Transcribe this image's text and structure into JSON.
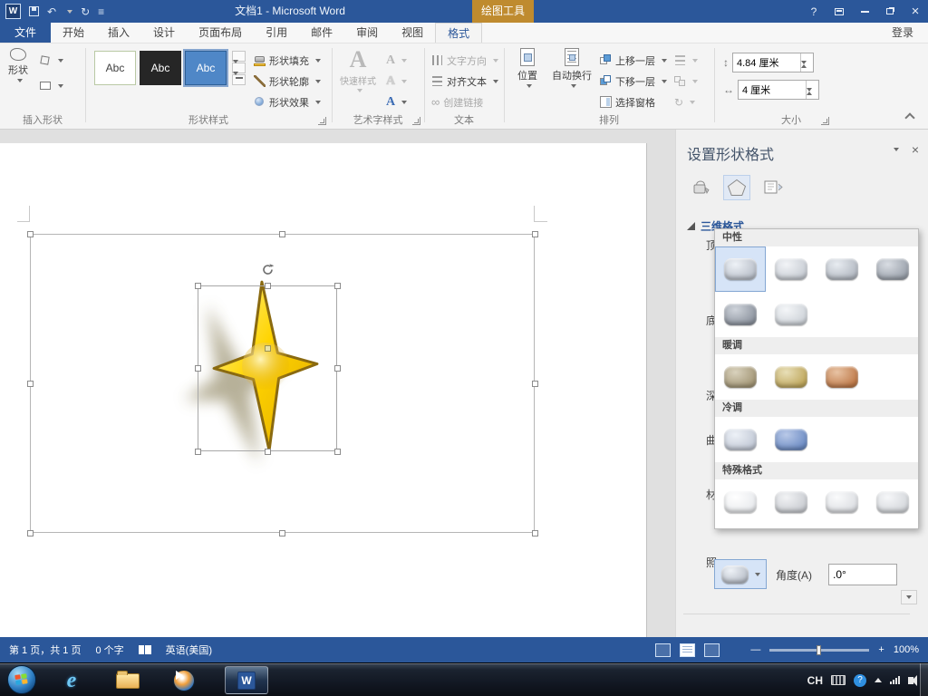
{
  "colors": {
    "titlebar_bg": "#2b579a",
    "contextual_bg": "#bf8b2f",
    "ribbon_bg": "#f4f4f4",
    "tabstrip_bg": "#f7f7f7",
    "accent": "#2b579a",
    "doc_bg": "#e0e0e0",
    "panel_bg": "#f0f0f0",
    "statusbar_bg": "#2b579a",
    "star_fill": "#ffd400",
    "star_stroke": "#8a6a10",
    "star_shadow": "#6e6233",
    "selection_fill": "#d6e4f7",
    "selection_border": "#84a7d3"
  },
  "icons": {
    "undo": "↶",
    "redo": "↻",
    "customize": "≡",
    "help": "?"
  },
  "titlebar": {
    "title": "文档1 - Microsoft Word",
    "contextual_label": "绘图工具"
  },
  "tabs": {
    "file": "文件",
    "items": [
      "开始",
      "插入",
      "设计",
      "页面布局",
      "引用",
      "邮件",
      "审阅",
      "视图"
    ],
    "active": "格式",
    "signin": "登录"
  },
  "ribbon": {
    "insert_shapes": {
      "label": "插入形状",
      "shapes": "形状"
    },
    "shape_styles": {
      "label": "形状样式",
      "tiles": [
        {
          "label": "Abc",
          "bg": "#ffffff",
          "fg": "#404040",
          "border": "#b9c9a4"
        },
        {
          "label": "Abc",
          "bg": "#262626",
          "fg": "#ffffff",
          "border": "#262626"
        },
        {
          "label": "Abc",
          "bg": "#4f87c7",
          "fg": "#ffffff",
          "border": "#2e5f96",
          "selected": true
        }
      ],
      "fill": "形状填充",
      "outline": "形状轮廓",
      "effects": "形状效果"
    },
    "wordart": {
      "label": "艺术字样式",
      "quick_styles": "快速样式",
      "letter": "A"
    },
    "text": {
      "label": "文本",
      "direction": "文字方向",
      "align": "对齐文本",
      "link": "创建链接"
    },
    "arrange": {
      "label": "排列",
      "position": "位置",
      "wrap": "自动换行",
      "forward": "上移一层",
      "backward": "下移一层",
      "pane": "选择窗格"
    },
    "size": {
      "label": "大小",
      "height_value": "4.84 厘米",
      "width_value": "4 厘米"
    }
  },
  "pane": {
    "title": "设置形状格式",
    "section": "三维格式",
    "row_labels": [
      "顶",
      "底",
      "深",
      "曲",
      "材",
      "照"
    ],
    "angle_label": "角度(A)",
    "angle_value": ".0°",
    "gallery": [
      {
        "header": "中性",
        "items": [
          {
            "base": "#b9bfc9",
            "light": "#eef2f7",
            "selected": true
          },
          {
            "base": "#c7ccd3",
            "light": "#f2f4f7"
          },
          {
            "base": "#b3b9c2",
            "light": "#e8ecf1"
          },
          {
            "base": "#9aa1ab",
            "light": "#d9dde3"
          },
          {
            "base": "#8d949f",
            "light": "#cfd4db"
          },
          {
            "base": "#ced3d9",
            "light": "#f4f6f8"
          }
        ]
      },
      {
        "header": "暖调",
        "items": [
          {
            "base": "#a39676",
            "light": "#d9d2bd"
          },
          {
            "base": "#bfa75c",
            "light": "#e8dfb8"
          },
          {
            "base": "#bf7a49",
            "light": "#e8c3a4"
          }
        ]
      },
      {
        "header": "冷调",
        "items": [
          {
            "base": "#c2c9d6",
            "light": "#edf1f7"
          },
          {
            "base": "#6d8cc4",
            "light": "#b9c9e8"
          }
        ]
      },
      {
        "header": "特殊格式",
        "items": [
          {
            "base": "#e8eaed",
            "light": "#ffffff"
          },
          {
            "base": "#c9ccd1",
            "light": "#f2f3f5"
          },
          {
            "base": "#dcdee2",
            "light": "#fafbfc"
          },
          {
            "base": "#d4d7db",
            "light": "#f6f7f9"
          }
        ]
      }
    ]
  },
  "statusbar": {
    "page_info": "第 1 页，共 1 页",
    "word_count": "0 个字",
    "language": "英语(美国)",
    "zoom_level": "100%",
    "zoom_out": "—",
    "zoom_in": "+"
  },
  "taskbar": {
    "lang_indicator": "CH"
  }
}
